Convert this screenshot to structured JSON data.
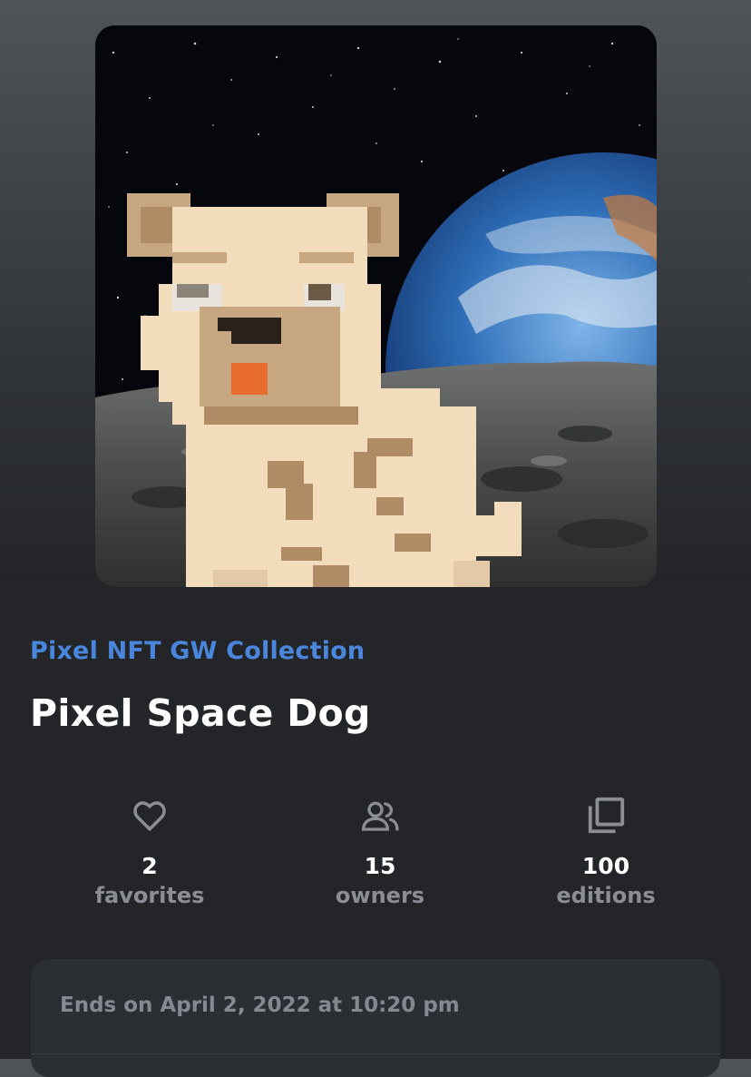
{
  "collection": {
    "name": "Pixel NFT GW Collection"
  },
  "nft": {
    "title": "Pixel Space Dog"
  },
  "stats": [
    {
      "count": "2",
      "label": "favorites",
      "icon": "heart-icon"
    },
    {
      "count": "15",
      "label": "owners",
      "icon": "users-icon"
    },
    {
      "count": "100",
      "label": "editions",
      "icon": "copy-icon"
    }
  ],
  "auction": {
    "ends_text": "Ends on April 2, 2022 at 10:20 pm"
  },
  "colors": {
    "accent": "#4a86db",
    "background": "#232529",
    "muted_text": "#8b8f95",
    "panel": "#2b2e33"
  }
}
